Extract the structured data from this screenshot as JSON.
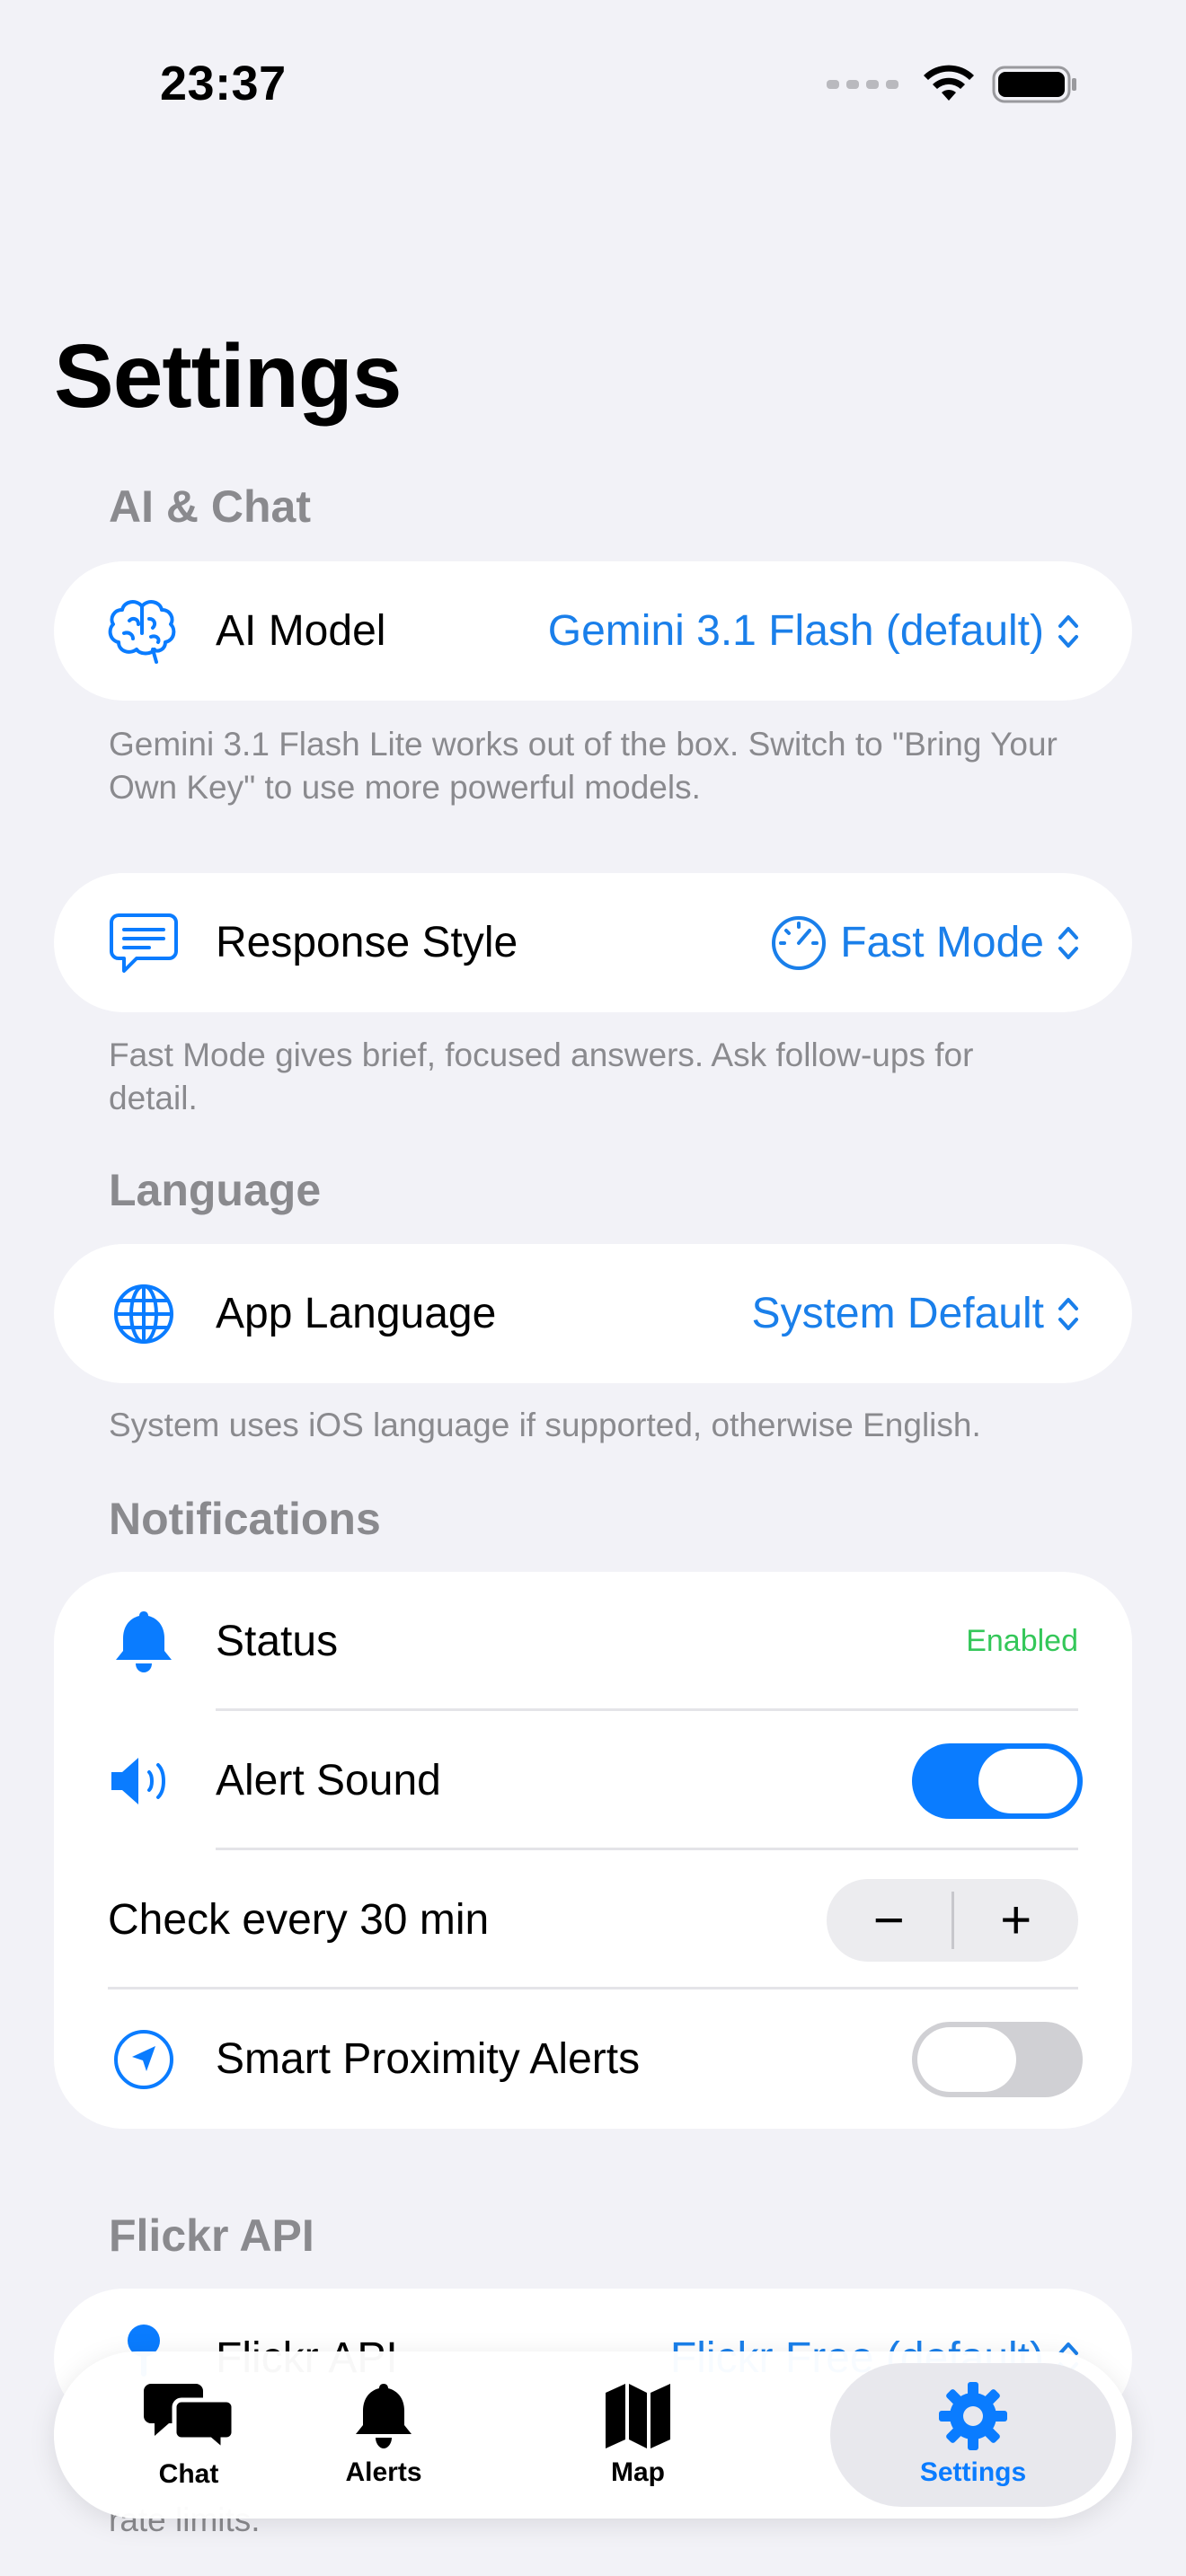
{
  "status_bar": {
    "time": "23:37"
  },
  "page_title": "Settings",
  "sections": {
    "ai_chat": {
      "header": "AI & Chat",
      "ai_model": {
        "label": "AI Model",
        "value": "Gemini 3.1 Flash (default)"
      },
      "ai_model_note": "Gemini 3.1 Flash Lite works out of the box. Switch to \"Bring Your Own Key\" to use more powerful models.",
      "response_style": {
        "label": "Response Style",
        "value": "Fast Mode"
      },
      "response_note": "Fast Mode gives brief, focused answers. Ask follow-ups for detail."
    },
    "language": {
      "header": "Language",
      "app_language": {
        "label": "App Language",
        "value": "System Default"
      },
      "note": "System uses iOS language if supported, otherwise English."
    },
    "notifications": {
      "header": "Notifications",
      "status": {
        "label": "Status",
        "value": "Enabled"
      },
      "alert_sound": {
        "label": "Alert Sound",
        "on": true
      },
      "check_every": {
        "label": "Check every 30 min",
        "minus": "−",
        "plus": "+"
      },
      "smart_proximity": {
        "label": "Smart Proximity Alerts",
        "on": false
      }
    },
    "flickr": {
      "header": "Flickr API",
      "flickr_api": {
        "label": "Flickr API",
        "value": "Flickr Free (default)"
      },
      "note": "rate limits."
    }
  },
  "tabbar": {
    "tabs": [
      {
        "label": "Chat",
        "icon": "chat-bubbles-icon",
        "active": false
      },
      {
        "label": "Alerts",
        "icon": "bell-icon",
        "active": false
      },
      {
        "label": "Map",
        "icon": "map-icon",
        "active": false
      },
      {
        "label": "Settings",
        "icon": "gear-icon",
        "active": true
      }
    ]
  },
  "colors": {
    "accent": "#0a7cff",
    "link": "#1a7fea",
    "enabled": "#34c759",
    "background": "#f2f2f7"
  }
}
